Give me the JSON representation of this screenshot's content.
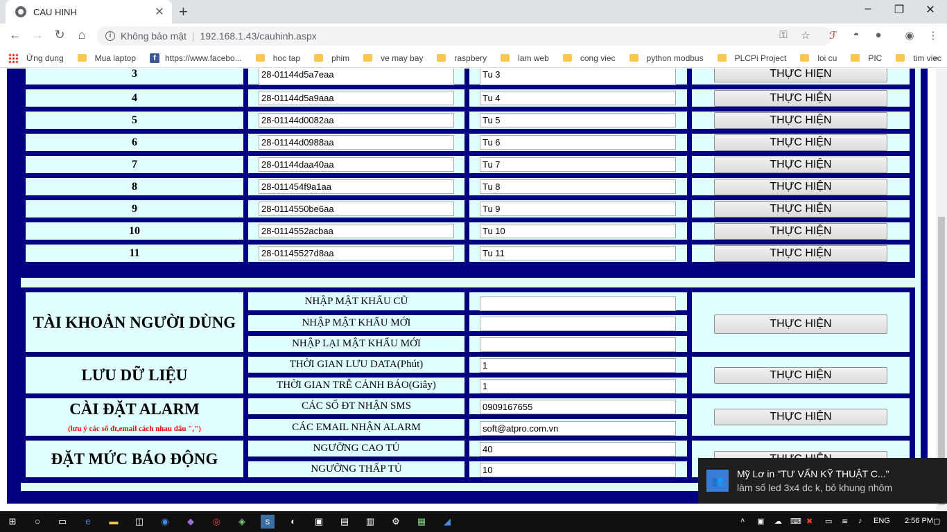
{
  "browser": {
    "tab_title": "CAU HINH",
    "new_tab": "+",
    "security_label": "Không bảo mật",
    "url": "192.168.1.43/cauhinh.aspx",
    "window_controls": {
      "minimize": "–",
      "maximize": "❐",
      "close": "✕"
    }
  },
  "bookmarks": [
    {
      "label": "Ứng dụng",
      "icon": "apps-icon"
    },
    {
      "label": "Mua laptop",
      "icon": "folder-icon"
    },
    {
      "label": "https://www.facebo...",
      "icon": "facebook-icon"
    },
    {
      "label": "hoc tap",
      "icon": "folder-icon"
    },
    {
      "label": "phim",
      "icon": "folder-icon"
    },
    {
      "label": "ve may bay",
      "icon": "folder-icon"
    },
    {
      "label": "raspbery",
      "icon": "folder-icon"
    },
    {
      "label": "lam web",
      "icon": "folder-icon"
    },
    {
      "label": "cong viec",
      "icon": "folder-icon"
    },
    {
      "label": "python modbus",
      "icon": "folder-icon"
    },
    {
      "label": "PLCPi Project",
      "icon": "folder-icon"
    },
    {
      "label": "loi cu",
      "icon": "folder-icon"
    },
    {
      "label": "PIC",
      "icon": "folder-icon"
    },
    {
      "label": "tim viec",
      "icon": "folder-icon"
    }
  ],
  "sensors": [
    {
      "num": "3",
      "id": "28-01144d5a7eaa",
      "name": "Tu 3"
    },
    {
      "num": "4",
      "id": "28-01144d5a9aaa",
      "name": "Tu 4"
    },
    {
      "num": "5",
      "id": "28-01144d0082aa",
      "name": "Tu 5"
    },
    {
      "num": "6",
      "id": "28-01144d0988aa",
      "name": "Tu 6"
    },
    {
      "num": "7",
      "id": "28-01144daa40aa",
      "name": "Tu 7"
    },
    {
      "num": "8",
      "id": "28-011454f9a1aa",
      "name": "Tu 8"
    },
    {
      "num": "9",
      "id": "28-0114550be6aa",
      "name": "Tu 9"
    },
    {
      "num": "10",
      "id": "28-0114552acbaa",
      "name": "Tu 10"
    },
    {
      "num": "11",
      "id": "28-01145527d8aa",
      "name": "Tu 11"
    }
  ],
  "action_label": "THỰC HIỆN",
  "account": {
    "title": "TÀI KHOẢN NGƯỜI DÙNG",
    "old_password": "NHẬP MẬT KHẨU CŨ",
    "new_password": "NHẬP MẬT KHẨU MỚI",
    "confirm_password": "NHẬP LẠI MẬT KHẨU MỚI"
  },
  "data_logging": {
    "title": "LƯU DỮ LIỆU",
    "save_interval_label": "THỜI GIAN LƯU DATA(Phút)",
    "save_interval_value": "1",
    "alarm_delay_label": "THỜI GIAN TRỄ CẢNH BÁO(Giây)",
    "alarm_delay_value": "1"
  },
  "alarm": {
    "title": "CÀI ĐẶT ALARM",
    "note": "(lưu ý các số đt,email cách nhau  dấu \",\")",
    "sms_label": "CÁC SỐ ĐT NHẬN SMS",
    "sms_value": "0909167655",
    "email_label": "CÁC EMAIL NHẬN ALARM",
    "email_value": "soft@atpro.com.vn"
  },
  "thresholds": {
    "title": "ĐẶT MỨC BÁO ĐỘNG",
    "high_label": "NGƯỠNG CAO TỦ",
    "high_value": "40",
    "low_label": "NGƯỠNG THẤP TỦ",
    "low_value": "10"
  },
  "toast": {
    "title": "Mỹ Lơ in \"TƯ VẤN KỸ THUẬT C...\"",
    "body": "làm số led 3x4 dc k, bỏ khung nhôm"
  },
  "taskbar": {
    "language": "ENG",
    "time": "2:56 PM"
  },
  "colors": {
    "table_border": "#000080",
    "cell_background": "#e0ffff",
    "note_color": "#ff0000"
  }
}
